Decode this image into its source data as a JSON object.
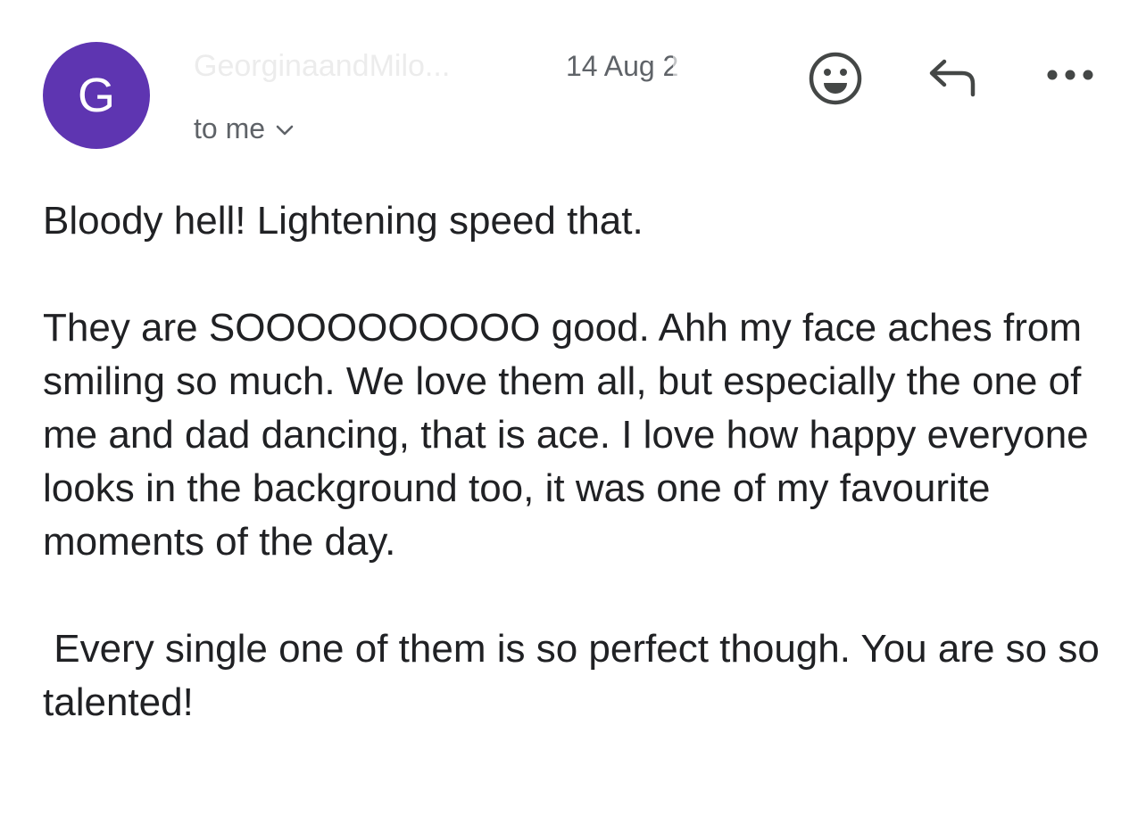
{
  "header": {
    "avatar_letter": "G",
    "avatar_color": "#5e35b1",
    "sender_name": "GeorginaandMilo...",
    "date": "14 Aug 2",
    "recipient_label": "to me",
    "icons": {
      "emoji": "add-reaction-icon",
      "reply": "reply-icon",
      "more": "more-options-icon",
      "chevron": "chevron-down-icon"
    }
  },
  "message": {
    "paragraphs": [
      "Bloody hell! Lightening speed that.",
      "They are SOOOOOOOOOO good. Ahh my face aches from smiling so much. We love them all, but especially the one of me and dad dancing, that is ace. I love how happy everyone looks in the background too, it was one of my favourite moments of the day.",
      " Every single one of them is so perfect though. You are so so talented!"
    ]
  }
}
